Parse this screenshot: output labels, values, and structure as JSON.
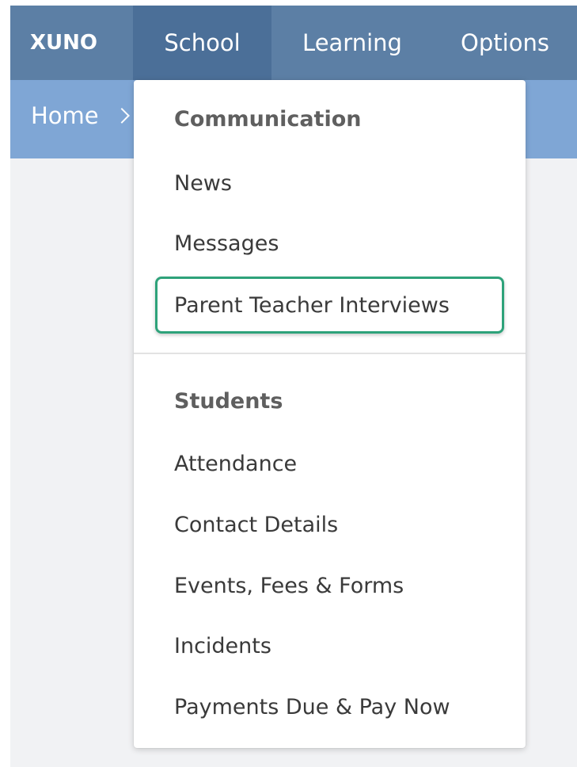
{
  "nav": {
    "brand": "XUNO",
    "items": [
      {
        "label": "School"
      },
      {
        "label": "Learning"
      },
      {
        "label": "Options"
      }
    ]
  },
  "breadcrumb": {
    "home": "Home"
  },
  "dropdown": {
    "sections": [
      {
        "title": "Communication",
        "items": [
          "News",
          "Messages",
          "Parent Teacher Interviews"
        ]
      },
      {
        "title": "Students",
        "items": [
          "Attendance",
          "Contact Details",
          "Events, Fees & Forms",
          "Incidents",
          "Payments Due & Pay Now"
        ]
      }
    ]
  },
  "colors": {
    "nav_bg": "#5c7fa5",
    "nav_active_bg": "#4b6f98",
    "breadcrumb_bg": "#7fa6d5",
    "highlight": "#2ea27a"
  }
}
